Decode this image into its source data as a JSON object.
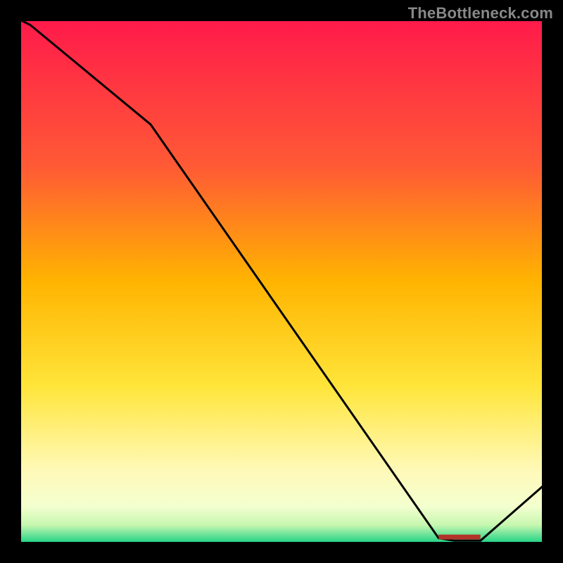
{
  "watermark": "TheBottleneck.com",
  "colors": {
    "top": "#ff1a4b",
    "upper_mid": "#ff7a2a",
    "mid": "#ffd400",
    "lower_mid": "#fff799",
    "near_bottom": "#fbffbf",
    "bottom": "#19d184",
    "line": "#000000",
    "marker": "#b2332a",
    "frame": "#000000"
  },
  "chart_data": {
    "type": "line",
    "title": "",
    "xlabel": "",
    "ylabel": "",
    "xlim": [
      0,
      100
    ],
    "ylim": [
      0,
      100
    ],
    "x": [
      0,
      2,
      25,
      80,
      83,
      88,
      100
    ],
    "values": [
      100,
      99,
      80,
      1,
      0.5,
      0.5,
      11
    ],
    "marker_segment": {
      "x0": 80,
      "x1": 88,
      "y": 1.2
    },
    "gradient_stops": [
      {
        "offset": 0.0,
        "color": "#ff1a4b"
      },
      {
        "offset": 0.28,
        "color": "#ff5a35"
      },
      {
        "offset": 0.5,
        "color": "#ffb400"
      },
      {
        "offset": 0.7,
        "color": "#ffe53a"
      },
      {
        "offset": 0.86,
        "color": "#fff9b8"
      },
      {
        "offset": 0.93,
        "color": "#f3ffcf"
      },
      {
        "offset": 0.965,
        "color": "#c7f7b0"
      },
      {
        "offset": 1.0,
        "color": "#19d184"
      }
    ]
  }
}
